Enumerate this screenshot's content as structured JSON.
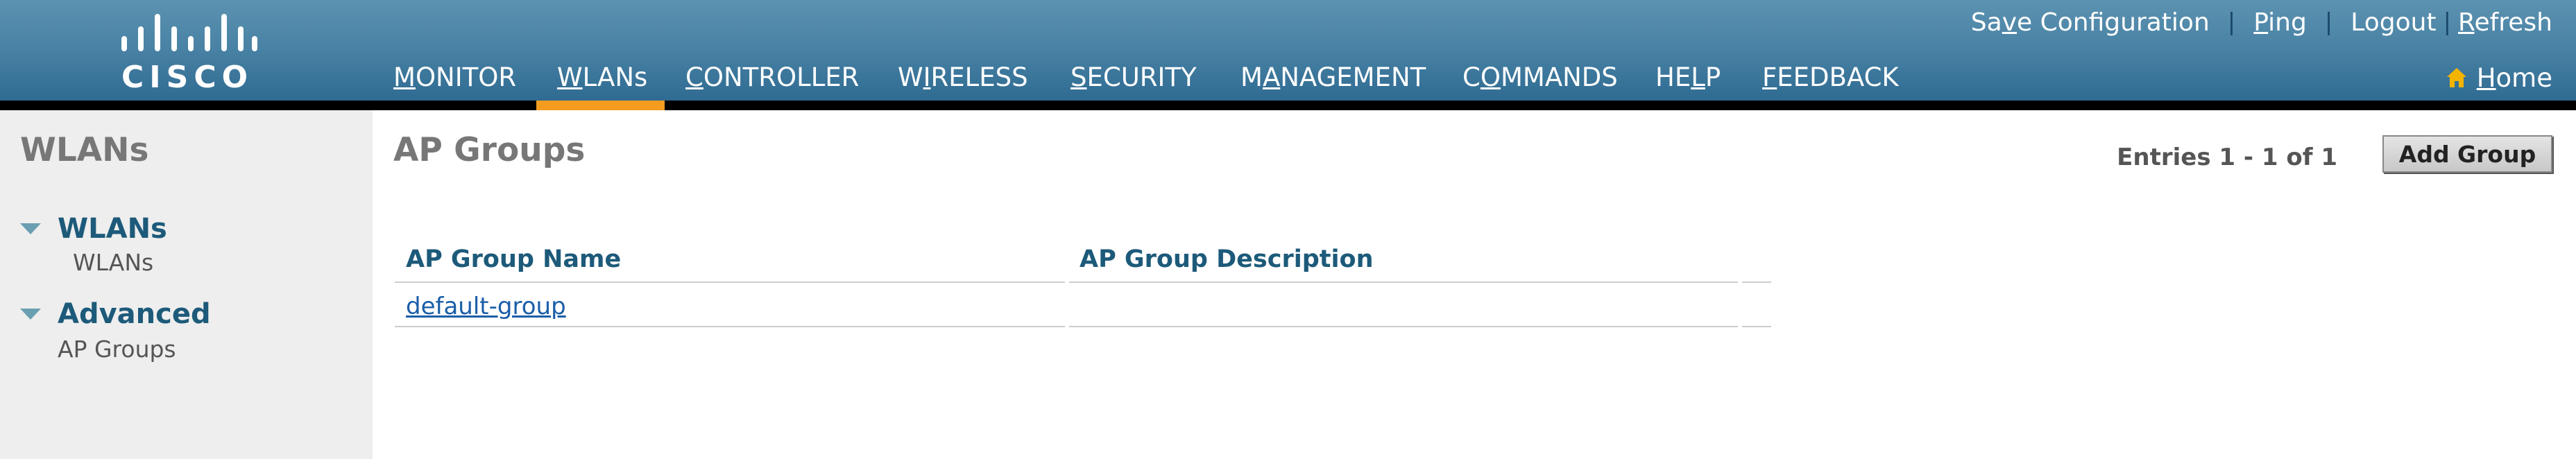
{
  "header": {
    "logo_text": "CISCO",
    "util_links": {
      "save_configuration": {
        "pre": "Sa",
        "u": "v",
        "post": "e Configuration"
      },
      "ping": {
        "pre": "",
        "u": "P",
        "post": "ing"
      },
      "logout": {
        "pre": "Logout",
        "u": "",
        "post": ""
      },
      "refresh": {
        "pre": "",
        "u": "R",
        "post": "efresh"
      }
    },
    "nav": [
      {
        "id": "monitor",
        "pre": "",
        "u": "M",
        "post": "ONITOR"
      },
      {
        "id": "wlans",
        "pre": "",
        "u": "W",
        "post": "LANs"
      },
      {
        "id": "controller",
        "pre": "",
        "u": "C",
        "post": "ONTROLLER"
      },
      {
        "id": "wireless",
        "pre": "W",
        "u": "I",
        "post": "RELESS"
      },
      {
        "id": "security",
        "pre": "",
        "u": "S",
        "post": "ECURITY"
      },
      {
        "id": "management",
        "pre": "M",
        "u": "A",
        "post": "NAGEMENT"
      },
      {
        "id": "commands",
        "pre": "C",
        "u": "O",
        "post": "MMANDS"
      },
      {
        "id": "help",
        "pre": "HE",
        "u": "L",
        "post": "P"
      },
      {
        "id": "feedback",
        "pre": "",
        "u": "F",
        "post": "EEDBACK"
      }
    ],
    "home": {
      "pre": "",
      "u": "H",
      "post": "ome"
    },
    "active_nav": "WLANs",
    "colors": {
      "header_top": "#5c92b1",
      "header_bottom": "#2f6b92",
      "active_tab": "#f39c1f"
    }
  },
  "sidebar": {
    "title": "WLANs",
    "sections": [
      {
        "label": "WLANs",
        "items": [
          "WLANs"
        ]
      },
      {
        "label": "Advanced",
        "items": [
          "AP Groups"
        ]
      }
    ]
  },
  "main": {
    "title": "AP Groups",
    "entries": "Entries 1 - 1 of 1",
    "add_button": "Add Group",
    "table": {
      "columns": [
        "AP Group Name",
        "AP Group Description"
      ],
      "rows": [
        {
          "name": "default-group",
          "description": ""
        }
      ]
    }
  }
}
